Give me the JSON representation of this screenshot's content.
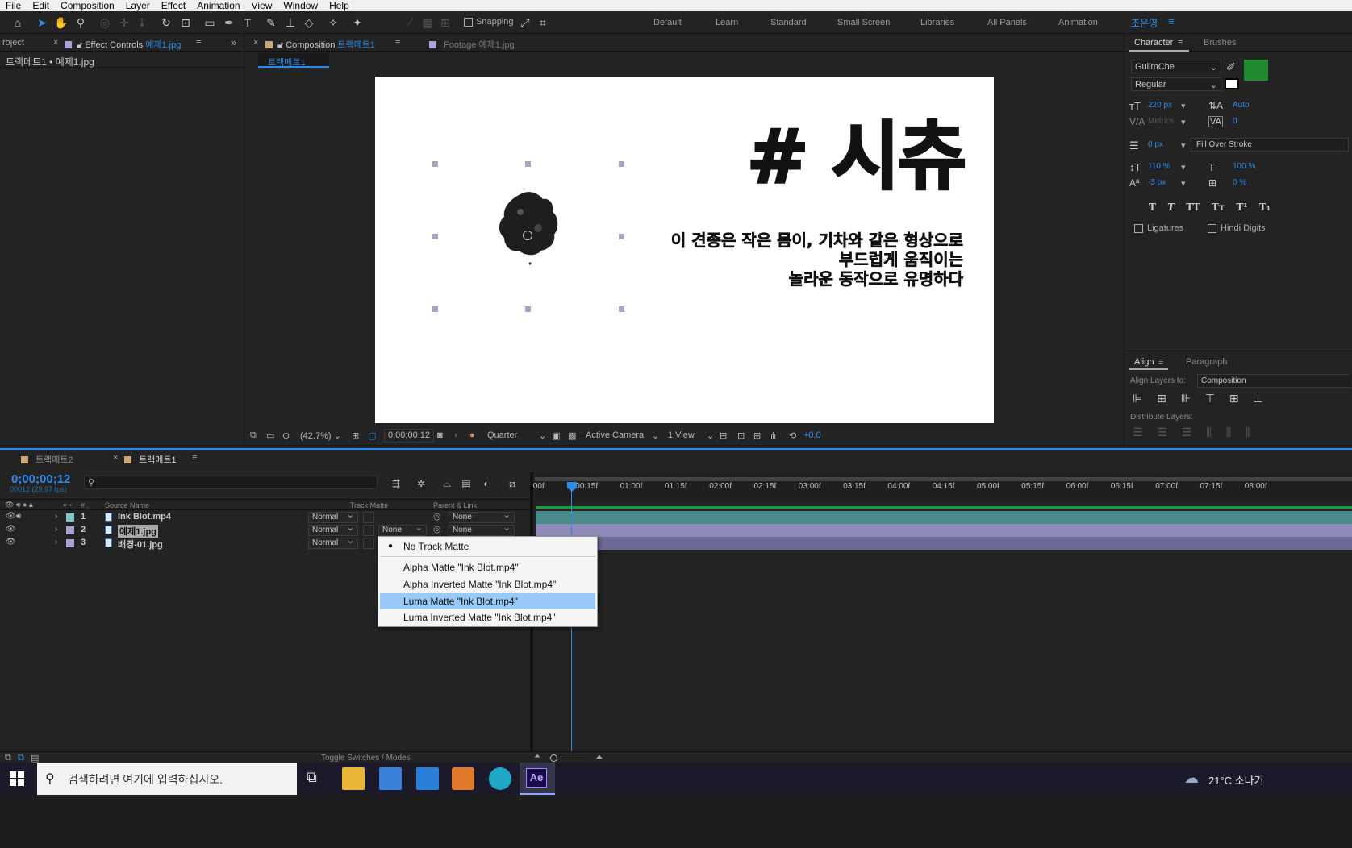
{
  "menu": [
    "File",
    "Edit",
    "Composition",
    "Layer",
    "Effect",
    "Animation",
    "View",
    "Window",
    "Help"
  ],
  "toolbar": {
    "snapping": "Snapping",
    "workspaces": [
      "Default",
      "Learn",
      "Standard",
      "Small Screen",
      "Libraries",
      "All Panels",
      "Animation"
    ],
    "user": "조은영"
  },
  "left_panel": {
    "tab_project": "roject",
    "tab_effect_controls": "Effect Controls",
    "effect_controls_target": "예제1.jpg",
    "breadcrumb": "트랙메트1 • 예제1.jpg"
  },
  "comp_panel": {
    "tab_composition": "Composition",
    "composition_name": "트랙메트1",
    "tab_footage": "Footage",
    "footage_name": "예제1.jpg",
    "sub_tab": "트랙메트1"
  },
  "viewer_content": {
    "headline": "# 시츄",
    "body_lines": [
      "이 견종은 작은 몸이, 기차와 같은 형상으로",
      "부드럽게 움직이는",
      "놀라운 동작으로 유명하다"
    ]
  },
  "viewer_bar": {
    "zoom": "(42.7%)",
    "timecode": "0;00;00;12",
    "resolution": "Quarter",
    "camera": "Active Camera",
    "view": "1 View",
    "exposure": "+0.0"
  },
  "character": {
    "tab": "Character",
    "tab_brushes": "Brushes",
    "font": "GulimChe",
    "style": "Regular",
    "size": "220 px",
    "leading": "Auto",
    "kerning": "Metrics",
    "tracking": "0",
    "stroke_width": "0 px",
    "stroke_mode": "Fill Over Stroke",
    "vscale": "110 %",
    "hscale": "100 %",
    "baseline": "-3 px",
    "tsume": "0 %",
    "ligatures": "Ligatures",
    "hindi_digits": "Hindi Digits",
    "fill_color": "#1f8a2e"
  },
  "align": {
    "tab": "Align",
    "tab_paragraph": "Paragraph",
    "align_to_label": "Align Layers to:",
    "align_to_value": "Composition",
    "distribute_label": "Distribute Layers:"
  },
  "timeline": {
    "tab_other": "트랙메트2",
    "tab_active": "트랙메트1",
    "timecode": "0;00;00;12",
    "frame_info": "00012 (29.97 fps)",
    "col_source": "Source Name",
    "col_track_matte": "Track Matte",
    "col_parent": "Parent & Link",
    "toggle": "Toggle Switches / Modes",
    "ruler": [
      ":00f",
      "00:15f",
      "01:00f",
      "01:15f",
      "02:00f",
      "02:15f",
      "03:00f",
      "03:15f",
      "04:00f",
      "04:15f",
      "05:00f",
      "05:15f",
      "06:00f",
      "06:15f",
      "07:00f",
      "07:15f",
      "08:00f"
    ],
    "layers": [
      {
        "num": "1",
        "name": "Ink Blot.mp4",
        "mode": "Normal",
        "matte": "",
        "parent": "None",
        "color": "#7fc8c8"
      },
      {
        "num": "2",
        "name": "예제1.jpg",
        "mode": "Normal",
        "matte": "None",
        "parent": "None",
        "color": "#a8a4d8"
      },
      {
        "num": "3",
        "name": "배경-01.jpg",
        "mode": "Normal",
        "matte": "",
        "parent": "",
        "color": "#a8a4d8"
      }
    ]
  },
  "matte_menu": {
    "items": [
      "No Track Matte",
      "Alpha Matte \"Ink Blot.mp4\"",
      "Alpha Inverted Matte \"Ink Blot.mp4\"",
      "Luma Matte \"Ink Blot.mp4\"",
      "Luma Inverted Matte \"Ink Blot.mp4\""
    ],
    "selected_index": 0,
    "highlighted_index": 3
  },
  "taskbar": {
    "search_placeholder": "검색하려면 여기에 입력하십시오.",
    "weather": "21°C 소나기",
    "ae_label": "Ae"
  }
}
